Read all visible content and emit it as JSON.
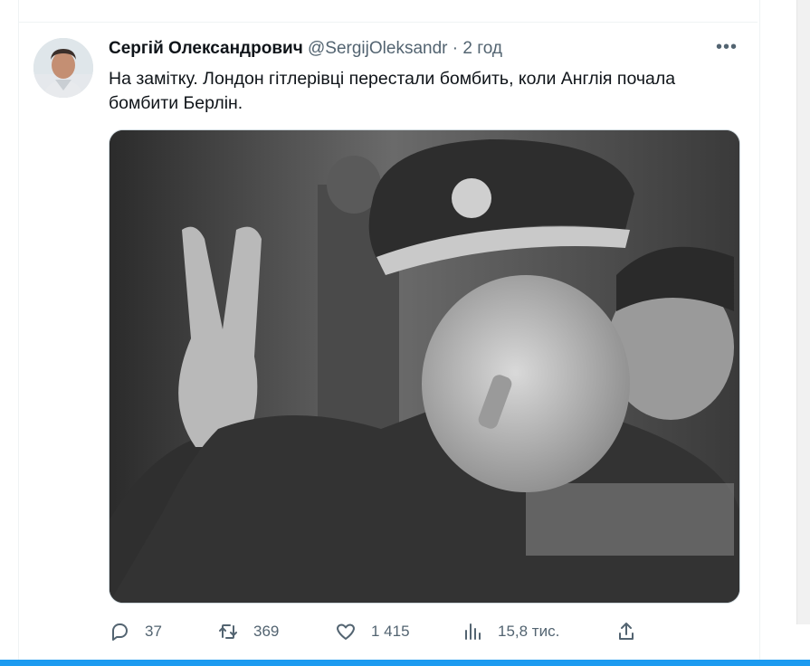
{
  "tweet": {
    "author_name": "Сергій Олександрович",
    "handle": "@SergijOleksandr",
    "separator": "·",
    "time": "2 год",
    "more": "•••",
    "text": "На замітку. Лондон гітлерівці перестали бомбить, коли Англія почала бомбити Берлін.",
    "media_icon": "photo",
    "actions": {
      "replies": "37",
      "retweets": "369",
      "likes": "1 415",
      "views": "15,8 тис."
    }
  },
  "colors": {
    "accent": "#1d9bf0",
    "text": "#0f1419",
    "secondary": "#536471"
  },
  "icons": [
    "reply-icon",
    "retweet-icon",
    "like-icon",
    "views-icon",
    "share-icon",
    "more-icon"
  ]
}
